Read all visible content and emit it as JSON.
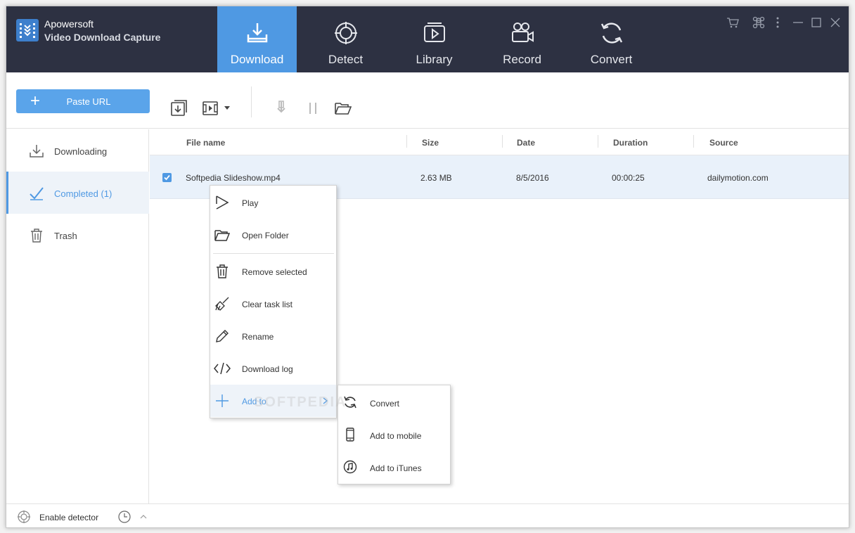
{
  "app": {
    "vendor": "Apowersoft",
    "title": "Video Download Capture",
    "accent": "#4f99e3",
    "header_bg": "#2d3142"
  },
  "nav": {
    "tabs": [
      {
        "label": "Download",
        "icon": "download-tray-icon",
        "active": true
      },
      {
        "label": "Detect",
        "icon": "crosshair-icon",
        "active": false
      },
      {
        "label": "Library",
        "icon": "video-library-icon",
        "active": false
      },
      {
        "label": "Record",
        "icon": "video-camera-icon",
        "active": false
      },
      {
        "label": "Convert",
        "icon": "convert-cycle-icon",
        "active": false
      }
    ]
  },
  "window_controls": [
    "cart-icon",
    "command-icon",
    "more-icon",
    "minimize-icon",
    "maximize-icon",
    "close-icon"
  ],
  "toolbar": {
    "paste_url_label": "Paste URL"
  },
  "sidebar": {
    "items": [
      {
        "label": "Downloading",
        "icon": "download-icon"
      },
      {
        "label": "Completed (1)",
        "icon": "check-icon",
        "active": true
      },
      {
        "label": "Trash",
        "icon": "trash-icon"
      }
    ]
  },
  "table": {
    "columns": [
      "File name",
      "Size",
      "Date",
      "Duration",
      "Source"
    ],
    "rows": [
      {
        "checked": true,
        "file_name": "Softpedia Slideshow.mp4",
        "size": "2.63 MB",
        "date": "8/5/2016",
        "duration": "00:00:25",
        "source": "dailymotion.com"
      }
    ]
  },
  "context_menu": {
    "items": [
      {
        "label": "Play",
        "icon": "play-icon"
      },
      {
        "label": "Open Folder",
        "icon": "folder-icon"
      },
      {
        "label": "Remove selected",
        "icon": "trash-icon"
      },
      {
        "label": "Clear task list",
        "icon": "broom-icon"
      },
      {
        "label": "Rename",
        "icon": "pencil-icon"
      },
      {
        "label": "Download log",
        "icon": "code-icon"
      },
      {
        "label": "Add to",
        "icon": "plus-icon",
        "has_submenu": true
      }
    ],
    "submenu": [
      {
        "label": "Convert",
        "icon": "convert-icon"
      },
      {
        "label": "Add to mobile",
        "icon": "mobile-icon"
      },
      {
        "label": "Add to iTunes",
        "icon": "music-note-icon"
      }
    ]
  },
  "footer": {
    "enable_detector_label": "Enable detector"
  },
  "watermark": "SOFTPEDIA"
}
